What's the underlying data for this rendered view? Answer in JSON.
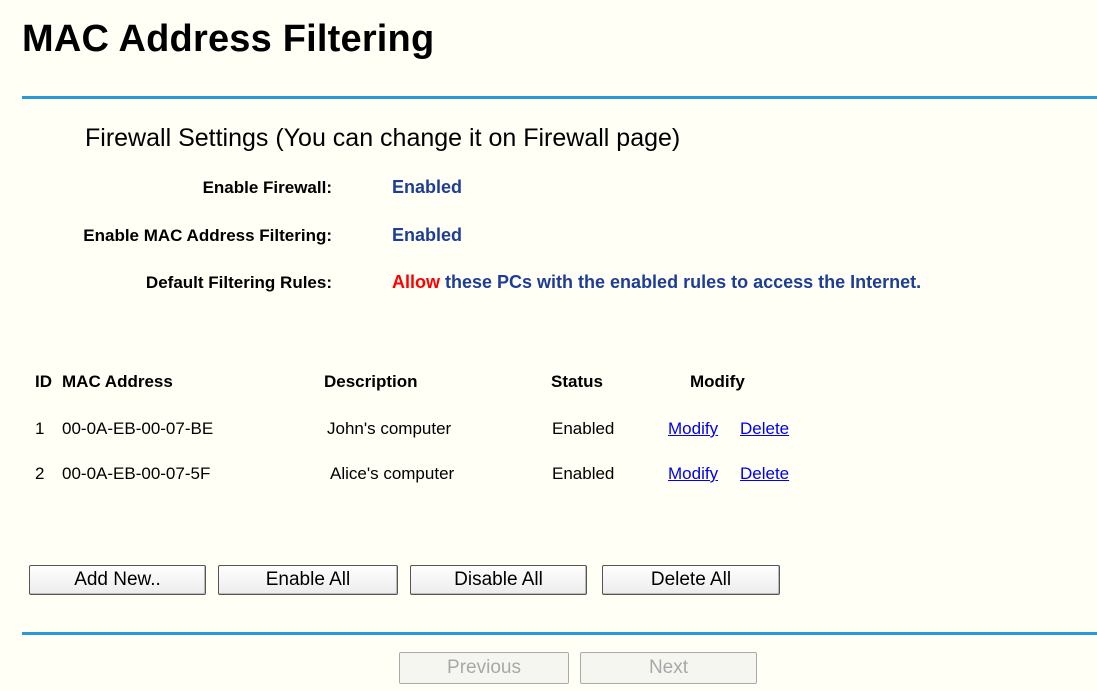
{
  "page": {
    "title": "MAC Address Filtering"
  },
  "firewall": {
    "section_title": "Firewall Settings (You can change it on Firewall page)",
    "settings": [
      {
        "label": "Enable Firewall:",
        "value": "Enabled"
      },
      {
        "label": "Enable MAC Address Filtering:",
        "value": "Enabled"
      },
      {
        "label": "Default Filtering Rules:",
        "value_highlight": "Allow",
        "value": "these PCs with the enabled rules to access the Internet."
      }
    ]
  },
  "table": {
    "headers": [
      "ID",
      "MAC Address",
      "Description",
      "Status",
      "Modify"
    ],
    "rows": [
      {
        "id": "1",
        "mac": "00-0A-EB-00-07-BE",
        "description": "John's computer",
        "status": "Enabled",
        "modify": "Modify",
        "delete": "Delete"
      },
      {
        "id": "2",
        "mac": "00-0A-EB-00-07-5F",
        "description": "Alice's computer",
        "status": "Enabled",
        "modify": "Modify",
        "delete": "Delete"
      }
    ]
  },
  "actions": {
    "add_new": "Add New..",
    "enable_all": "Enable All",
    "disable_all": "Disable All",
    "delete_all": "Delete All"
  },
  "pagination": {
    "previous": "Previous",
    "next": "Next"
  },
  "colors": {
    "accent_rule": "#2a9ad6",
    "value_text": "#1e3d96",
    "highlight": "#ff0000",
    "link": "#0000ee",
    "background": "#fffff5"
  }
}
